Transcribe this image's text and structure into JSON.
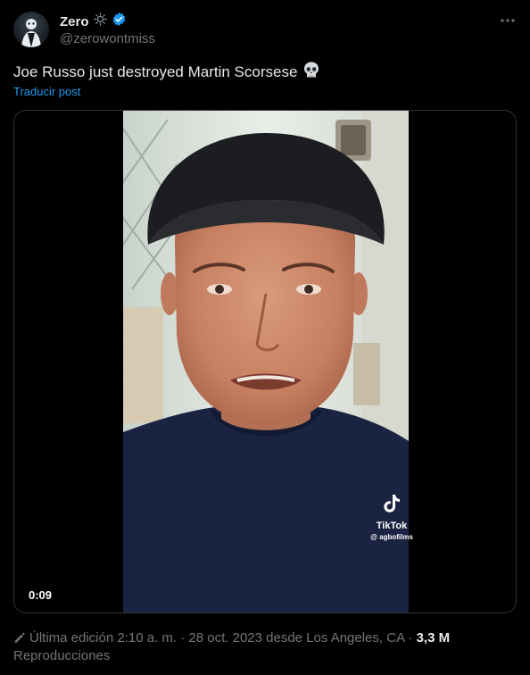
{
  "author": {
    "display_name": "Zero",
    "handle": "@zerowontmiss",
    "verified": true,
    "accent": "#1d9bf0"
  },
  "post": {
    "text": "Joe Russo just destroyed Martin Scorsese",
    "emoji": "skull-emoji",
    "translate_label": "Traducir post"
  },
  "video": {
    "duration": "0:09",
    "watermark_brand": "TikTok",
    "watermark_handle": "@ agbofilms"
  },
  "meta": {
    "edited_label": "Última edición 2:10 a. m. · 28 oct. 2023 desde Los Angeles, CA ·",
    "views_count": "3,3 M",
    "views_label": "Reproducciones"
  },
  "colors": {
    "background": "#000000",
    "text_primary": "#e7e9ea",
    "text_secondary": "#71767b",
    "link": "#1d9bf0",
    "border": "#2f3336"
  }
}
